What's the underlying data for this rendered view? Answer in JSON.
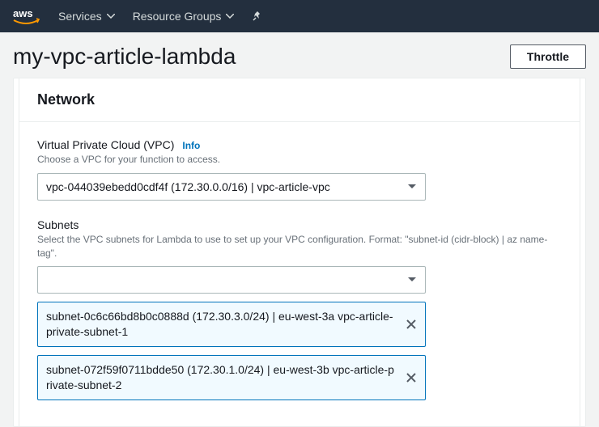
{
  "nav": {
    "services": "Services",
    "resource_groups": "Resource Groups"
  },
  "header": {
    "title": "my-vpc-article-lambda",
    "throttle": "Throttle"
  },
  "network": {
    "panel_title": "Network",
    "vpc": {
      "label": "Virtual Private Cloud (VPC)",
      "info": "Info",
      "desc": "Choose a VPC for your function to access.",
      "value": "vpc-044039ebedd0cdf4f (172.30.0.0/16) | vpc-article-vpc"
    },
    "subnets": {
      "label": "Subnets",
      "desc": "Select the VPC subnets for Lambda to use to set up your VPC configuration. Format: \"subnet-id (cidr-block) | az name-tag\".",
      "value": "",
      "selected": [
        "subnet-0c6c66bd8b0c0888d (172.30.3.0/24) | eu-west-3a vpc-article-private-subnet-1",
        "subnet-072f59f0711bdde50 (172.30.1.0/24) | eu-west-3b vpc-article-private-subnet-2"
      ]
    }
  }
}
